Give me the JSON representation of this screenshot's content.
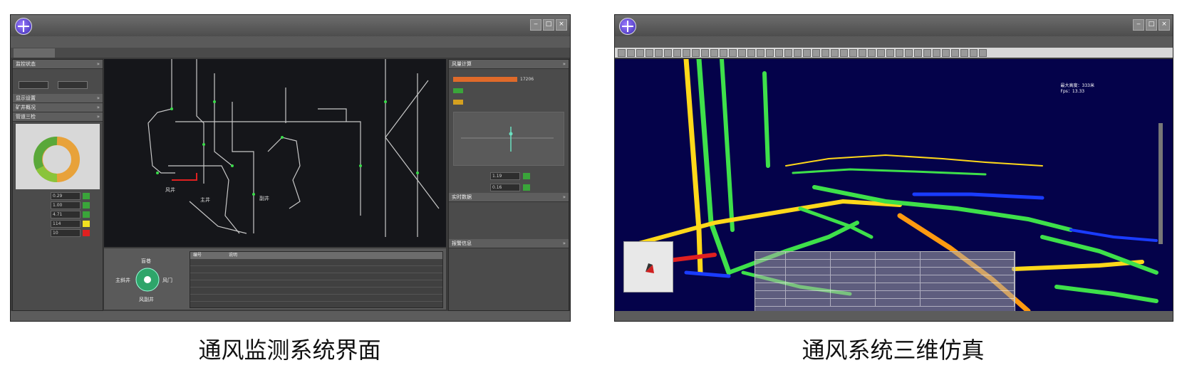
{
  "captions": {
    "left": "通风监测系统界面",
    "right": "通风系统三维仿真"
  },
  "left_window": {
    "panels": {
      "left_sections": [
        "监控状态",
        "显示设置",
        "矿井概况",
        "管道三检"
      ],
      "right_sections": [
        "风量计算",
        "实时数据",
        "报警信息"
      ],
      "compass_labels": {
        "north": "盲巷",
        "west": "主斜井",
        "east": "风门",
        "south": "风副井"
      }
    },
    "metrics": [
      {
        "value": "0.29",
        "led": "#3aa53a"
      },
      {
        "value": "1.00",
        "led": "#3aa53a"
      },
      {
        "value": "4.71",
        "led": "#3aa53a"
      },
      {
        "value": "114",
        "led": "#f0e020"
      },
      {
        "value": "10",
        "led": "#e02020"
      }
    ],
    "map_labels": [
      "风井",
      "主井",
      "副井"
    ],
    "alarm_header": [
      "编号",
      "说明"
    ],
    "right_values": [
      "17206",
      "1.19",
      "0.16"
    ],
    "colors": {
      "bar1": "#e06a2a",
      "bar2": "#3aa53a",
      "bar3": "#d4a020"
    }
  },
  "right_window": {
    "overlay_right": [
      "最大高度：333米",
      "Fps：13.33"
    ],
    "colors": {
      "pipe_green": "#3ee04a",
      "pipe_yellow": "#ffd81a",
      "pipe_blue": "#1a3cff",
      "pipe_orange": "#ff9a10",
      "background": "#04024a"
    }
  }
}
